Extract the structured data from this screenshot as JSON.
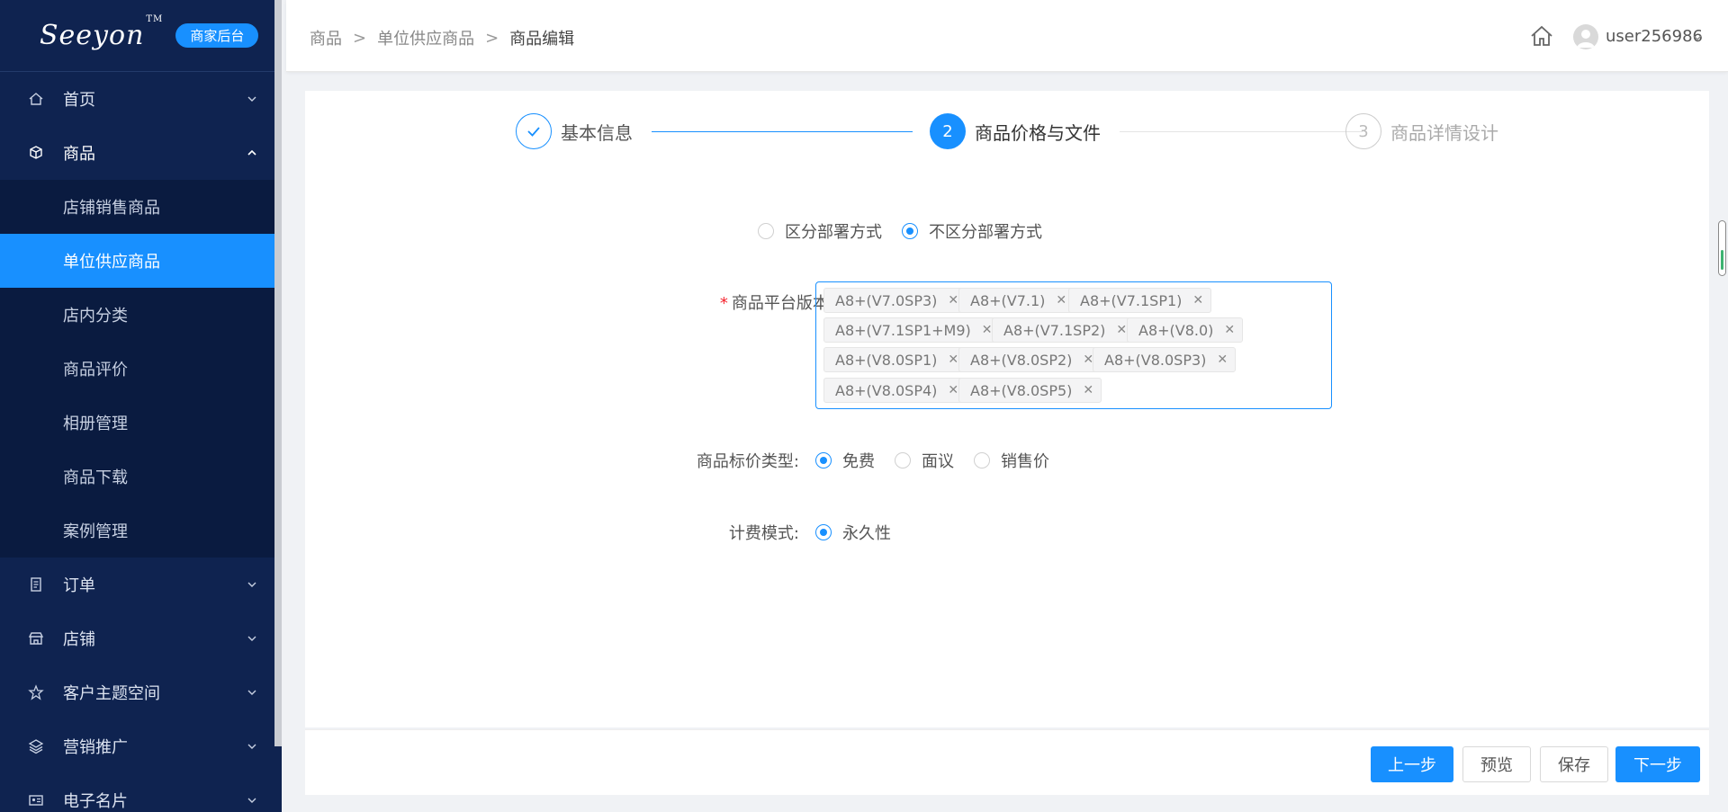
{
  "brand": {
    "logo_text": "Seeyon",
    "tm": "TM",
    "badge": "商家后台"
  },
  "sidebar": {
    "items": [
      {
        "label": "首页",
        "icon": "home-icon"
      },
      {
        "label": "商品",
        "icon": "cube-icon",
        "open": true,
        "children": [
          {
            "label": "店铺销售商品"
          },
          {
            "label": "单位供应商品",
            "active": true
          },
          {
            "label": "店内分类"
          },
          {
            "label": "商品评价"
          },
          {
            "label": "相册管理"
          },
          {
            "label": "商品下载"
          },
          {
            "label": "案例管理"
          }
        ]
      },
      {
        "label": "订单",
        "icon": "document-icon"
      },
      {
        "label": "店铺",
        "icon": "store-icon"
      },
      {
        "label": "客户主题空间",
        "icon": "star-icon"
      },
      {
        "label": "营销推广",
        "icon": "layers-icon"
      },
      {
        "label": "电子名片",
        "icon": "id-card-icon"
      }
    ]
  },
  "header": {
    "breadcrumb": [
      "商品",
      "单位供应商品",
      "商品编辑"
    ],
    "username": "user256986"
  },
  "steps": [
    {
      "number": "✓",
      "label": "基本信息",
      "status": "done"
    },
    {
      "number": "2",
      "label": "商品价格与文件",
      "status": "active"
    },
    {
      "number": "3",
      "label": "商品详情设计",
      "status": "pending"
    }
  ],
  "form": {
    "deploy_options": [
      {
        "label": "区分部署方式",
        "checked": false
      },
      {
        "label": "不区分部署方式",
        "checked": true
      }
    ],
    "platform_label": "商品平台版本:",
    "platform_tags": [
      "A8+(V7.0SP3)",
      "A8+(V7.1)",
      "A8+(V7.1SP1)",
      "A8+(V7.1SP1+M9)",
      "A8+(V7.1SP2)",
      "A8+(V8.0)",
      "A8+(V8.0SP1)",
      "A8+(V8.0SP2)",
      "A8+(V8.0SP3)",
      "A8+(V8.0SP4)",
      "A8+(V8.0SP5)"
    ],
    "price_type_label": "商品标价类型:",
    "price_type_options": [
      {
        "label": "免费",
        "checked": true
      },
      {
        "label": "面议",
        "checked": false
      },
      {
        "label": "销售价",
        "checked": false
      }
    ],
    "billing_label": "计费模式:",
    "billing_options": [
      {
        "label": "永久性",
        "checked": true
      }
    ]
  },
  "actions": {
    "prev": "上一步",
    "preview": "预览",
    "save": "保存",
    "next": "下一步"
  },
  "colors": {
    "primary": "#1890ff",
    "sidebar_bg": "#0f2350",
    "required": "#f5222d"
  }
}
